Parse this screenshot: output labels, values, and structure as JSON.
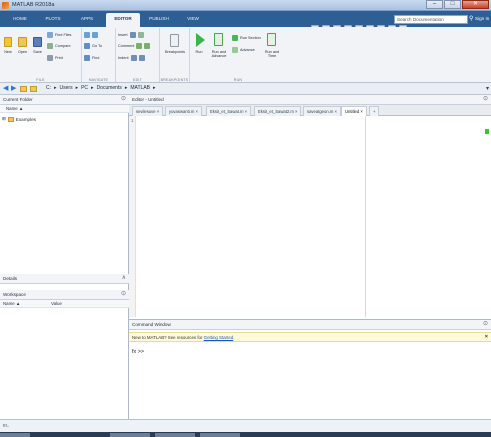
{
  "window": {
    "title": "MATLAB R2018a",
    "min": "–",
    "max": "□",
    "close": "✕"
  },
  "tabs": [
    {
      "label": "HOME",
      "active": false
    },
    {
      "label": "PLOTS",
      "active": false
    },
    {
      "label": "APPS",
      "active": false
    },
    {
      "label": "EDITOR",
      "active": true
    },
    {
      "label": "PUBLISH",
      "active": false
    },
    {
      "label": "VIEW",
      "active": false
    }
  ],
  "search": {
    "placeholder": "Search Documentation",
    "signin": "Sign In"
  },
  "ribbon": {
    "file": {
      "label": "FILE",
      "new": "New",
      "open": "Open",
      "save": "Save",
      "find_files": "Find Files",
      "compare": "Compare",
      "print": "Print"
    },
    "navigate": {
      "label": "NAVIGATE",
      "goto": "Go To",
      "find": "Find"
    },
    "edit": {
      "label": "EDIT",
      "insert": "Insert",
      "comment": "Comment",
      "indent": "Indent"
    },
    "breakpoints": {
      "label": "BREAKPOINTS",
      "breakpoints": "Breakpoints"
    },
    "run": {
      "label": "RUN",
      "run": "Run",
      "run_and_advance": "Run and Advance",
      "run_section": "Run Section",
      "advance": "Advance",
      "run_and_time": "Run and Time"
    }
  },
  "address": {
    "path": [
      "C:",
      "Users",
      "PC",
      "Documents",
      "MATLAB"
    ]
  },
  "current_folder": {
    "title": "Current Folder",
    "name_col": "Name ▲",
    "items": [
      {
        "name": "Examples"
      }
    ]
  },
  "details": {
    "title": "Details"
  },
  "workspace": {
    "title": "Workspace",
    "name_col": "Name ▲",
    "value_col": "Value"
  },
  "editor": {
    "title": "Editor - Untitled",
    "tabs": [
      "sevilesuve",
      "yuvaswanti.m",
      "Eksit_et_Sawat.m",
      "Eksit_et_Sawat2.m",
      "saveatgeon.m",
      "Untitled"
    ],
    "plus": "+",
    "line_numbers": [
      "1"
    ]
  },
  "command": {
    "title": "Command Window",
    "notice": "New to MATLAB? See resources for ",
    "link": "Getting Started",
    "notice_end": ".",
    "prompt": "fx >>"
  },
  "status": {
    "text": "!!!.."
  }
}
